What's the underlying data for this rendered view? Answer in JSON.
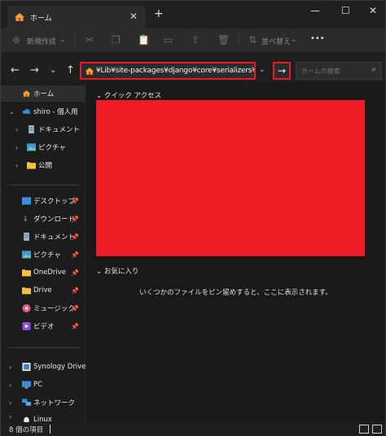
{
  "tab": {
    "title": "ホーム",
    "close": "✕",
    "new_tab": "+"
  },
  "window_controls": {
    "minimize": "—",
    "maximize": "☐",
    "close": "✕"
  },
  "toolbar": {
    "new_label": "新規作成",
    "new_chevron": "⌄",
    "sort_label": "並べ替え",
    "sort_chevron": "⌄",
    "more": "•••"
  },
  "address": {
    "path": "¥Lib¥site-packages¥django¥core¥serializers¥json.py",
    "go": "→",
    "dropdown": "⌄"
  },
  "search": {
    "placeholder": "ホームの検索",
    "icon": "search-icon"
  },
  "nav": {
    "back": "←",
    "forward": "→",
    "history": "⌄",
    "up": "↑"
  },
  "sidebar": {
    "items": [
      {
        "label": "ホーム",
        "icon": "home-icon",
        "selected": true
      },
      {
        "label": "shiro - 個人用",
        "icon": "onedrive-cloud-icon",
        "expanded": true
      },
      {
        "label": "ドキュメント",
        "icon": "document-icon"
      },
      {
        "label": "ピクチャ",
        "icon": "pictures-icon"
      },
      {
        "label": "公開",
        "icon": "folder-icon"
      }
    ],
    "pinned": [
      {
        "label": "デスクトップ",
        "icon": "desktop-icon"
      },
      {
        "label": "ダウンロード",
        "icon": "download-icon"
      },
      {
        "label": "ドキュメント",
        "icon": "document-icon"
      },
      {
        "label": "ピクチャ",
        "icon": "pictures-icon"
      },
      {
        "label": "OneDrive",
        "icon": "folder-icon"
      },
      {
        "label": "Drive",
        "icon": "folder-icon"
      },
      {
        "label": "ミュージック",
        "icon": "music-icon"
      },
      {
        "label": "ビデオ",
        "icon": "video-icon"
      }
    ],
    "locations": [
      {
        "label": "Synology Drive",
        "icon": "synology-drive-icon"
      },
      {
        "label": "PC",
        "icon": "pc-icon"
      },
      {
        "label": "ネットワーク",
        "icon": "network-icon"
      },
      {
        "label": "Linux",
        "icon": "linux-icon"
      }
    ]
  },
  "main": {
    "quick_access": "クイック アクセス",
    "favorites": "お気に入り",
    "favorites_empty": "いくつかのファイルをピン留めすると、ここに表示されます。"
  },
  "status": {
    "item_count": "8 個の項目"
  },
  "colors": {
    "highlight": "#e81b23",
    "redacted_block": "#ee1c25",
    "background": "#191919"
  }
}
